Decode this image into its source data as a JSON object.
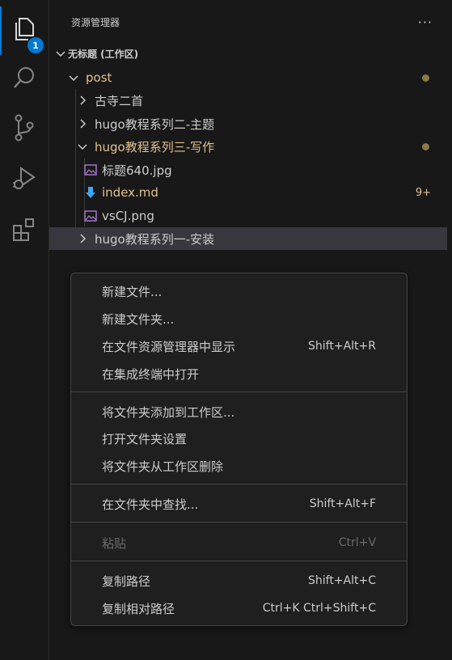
{
  "activity_bar": {
    "items": [
      {
        "icon": "files-icon",
        "badge": "1"
      },
      {
        "icon": "search-icon"
      },
      {
        "icon": "source-control-icon"
      },
      {
        "icon": "run-debug-icon"
      },
      {
        "icon": "extensions-icon"
      }
    ],
    "accent_color": "#0078d4"
  },
  "sidebar": {
    "title": "资源管理器",
    "more": "···",
    "workspace_title": "无标题 (工作区)"
  },
  "tree": [
    {
      "label": "post",
      "kind": "folder",
      "expanded": true,
      "color": "#e2c08d",
      "modified_dot": true
    },
    {
      "label": "古寺二首",
      "kind": "folder",
      "expanded": false
    },
    {
      "label": "hugo教程系列二-主题",
      "kind": "folder",
      "expanded": false
    },
    {
      "label": "hugo教程系列三-写作",
      "kind": "folder",
      "expanded": true,
      "color": "#e2c08d",
      "modified_dot": true
    },
    {
      "label": "标题640.jpg",
      "kind": "image"
    },
    {
      "label": "index.md",
      "kind": "markdown",
      "color": "#e2c08d",
      "count": "9+"
    },
    {
      "label": "vsCJ.png",
      "kind": "image"
    },
    {
      "label": "hugo教程系列一-安装",
      "kind": "folder",
      "expanded": false,
      "selected": true
    }
  ],
  "context_menu": {
    "groups": [
      [
        {
          "label": "新建文件...",
          "shortcut": ""
        },
        {
          "label": "新建文件夹...",
          "shortcut": ""
        },
        {
          "label": "在文件资源管理器中显示",
          "shortcut": "Shift+Alt+R"
        },
        {
          "label": "在集成终端中打开",
          "shortcut": ""
        }
      ],
      [
        {
          "label": "将文件夹添加到工作区...",
          "shortcut": ""
        },
        {
          "label": "打开文件夹设置",
          "shortcut": ""
        },
        {
          "label": "将文件夹从工作区删除",
          "shortcut": ""
        }
      ],
      [
        {
          "label": "在文件夹中查找...",
          "shortcut": "Shift+Alt+F"
        }
      ],
      [
        {
          "label": "粘贴",
          "shortcut": "Ctrl+V",
          "disabled": true
        }
      ],
      [
        {
          "label": "复制路径",
          "shortcut": "Shift+Alt+C"
        },
        {
          "label": "复制相对路径",
          "shortcut": "Ctrl+K Ctrl+Shift+C"
        }
      ]
    ]
  }
}
